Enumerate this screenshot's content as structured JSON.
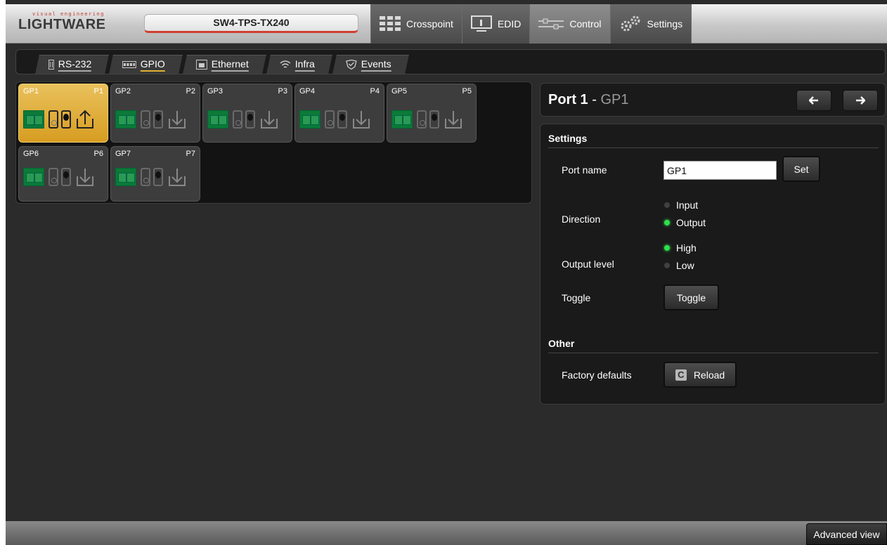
{
  "header": {
    "logo_tagline": "visual engineering",
    "logo_word": "LIGHTWARE",
    "device_name": "SW4-TPS-TX240",
    "nav_tabs": [
      {
        "label": "Crosspoint",
        "icon": "grid-icon"
      },
      {
        "label": "EDID",
        "icon": "monitor-icon"
      },
      {
        "label": "Control",
        "icon": "sliders-icon"
      },
      {
        "label": "Settings",
        "icon": "gears-icon"
      }
    ],
    "active_tab": "Control"
  },
  "subtabs": [
    {
      "label": "RS-232",
      "icon": "serial-icon"
    },
    {
      "label": "GPIO",
      "icon": "gpio-icon"
    },
    {
      "label": "Ethernet",
      "icon": "ethernet-icon"
    },
    {
      "label": "Infra",
      "icon": "wifi-icon"
    },
    {
      "label": "Events",
      "icon": "shield-icon"
    }
  ],
  "active_subtab": "GPIO",
  "ports": [
    {
      "name": "GP1",
      "port": "P1",
      "direction": "output",
      "active": true
    },
    {
      "name": "GP2",
      "port": "P2",
      "direction": "input",
      "active": false
    },
    {
      "name": "GP3",
      "port": "P3",
      "direction": "input",
      "active": false
    },
    {
      "name": "GP4",
      "port": "P4",
      "direction": "input",
      "active": false
    },
    {
      "name": "GP5",
      "port": "P5",
      "direction": "input",
      "active": false
    },
    {
      "name": "GP6",
      "port": "P6",
      "direction": "input",
      "active": false
    },
    {
      "name": "GP7",
      "port": "P7",
      "direction": "input",
      "active": false
    }
  ],
  "detail": {
    "title_bold": "Port 1",
    "title_sep": " - ",
    "title_sub": "GP1",
    "prev_icon": "arrow-left-icon",
    "next_icon": "arrow-right-icon",
    "settings_heading": "Settings",
    "port_name_label": "Port name",
    "port_name_value": "GP1",
    "set_button": "Set",
    "direction_label": "Direction",
    "direction_options": [
      "Input",
      "Output"
    ],
    "direction_selected": "Output",
    "output_level_label": "Output level",
    "output_level_options": [
      "High",
      "Low"
    ],
    "output_level_selected": "High",
    "toggle_label": "Toggle",
    "toggle_button": "Toggle",
    "other_heading": "Other",
    "factory_label": "Factory defaults",
    "reload_button": "Reload"
  },
  "footer": {
    "advanced_view": "Advanced view"
  },
  "colors": {
    "accent_gold": "#e0b030",
    "led_green": "#2ee04a",
    "connector_green": "#0c7a38",
    "brand_red": "#d04030"
  }
}
